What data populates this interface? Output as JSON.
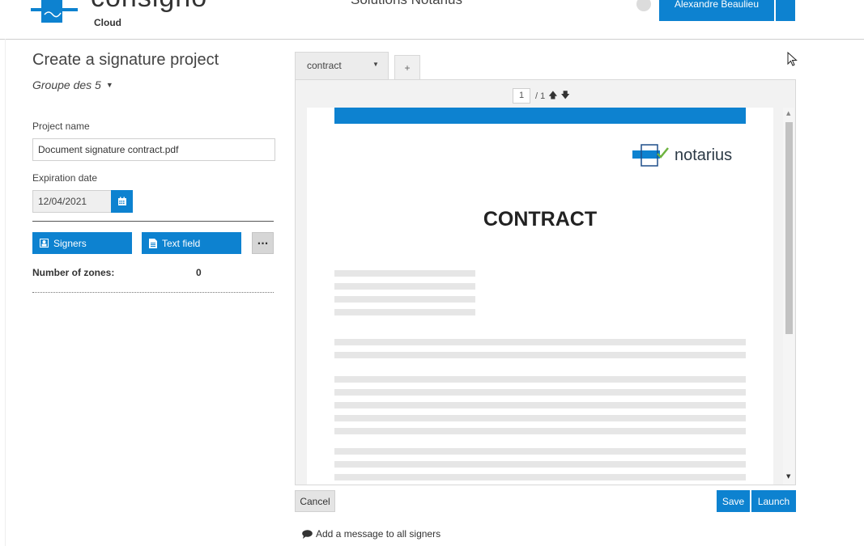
{
  "header": {
    "logo_word": "consigno",
    "logo_sub": "Cloud",
    "organization": "Solutions Notarius",
    "user_name": "Alexandre Beaulieu"
  },
  "sidebar": {
    "title": "Create a signature project",
    "group": "Groupe des 5",
    "project_name_label": "Project name",
    "project_name_value": "Document signature contract.pdf",
    "expiration_label": "Expiration date",
    "expiration_value": "12/04/2021",
    "signers_label": "Signers",
    "text_field_label": "Text field",
    "more_label": "···",
    "zones_label": "Number of zones:",
    "zones_value": "0"
  },
  "tabs": [
    {
      "label": "contract"
    },
    {
      "label": "+"
    }
  ],
  "viewer": {
    "page_current": "1",
    "page_total": "/ 1",
    "doc_logo_word": "notarius",
    "doc_title": "CONTRACT"
  },
  "actions": {
    "cancel": "Cancel",
    "save": "Save",
    "launch": "Launch",
    "message_link": "Add a message to all signers"
  },
  "colors": {
    "accent": "#0d82d0"
  }
}
